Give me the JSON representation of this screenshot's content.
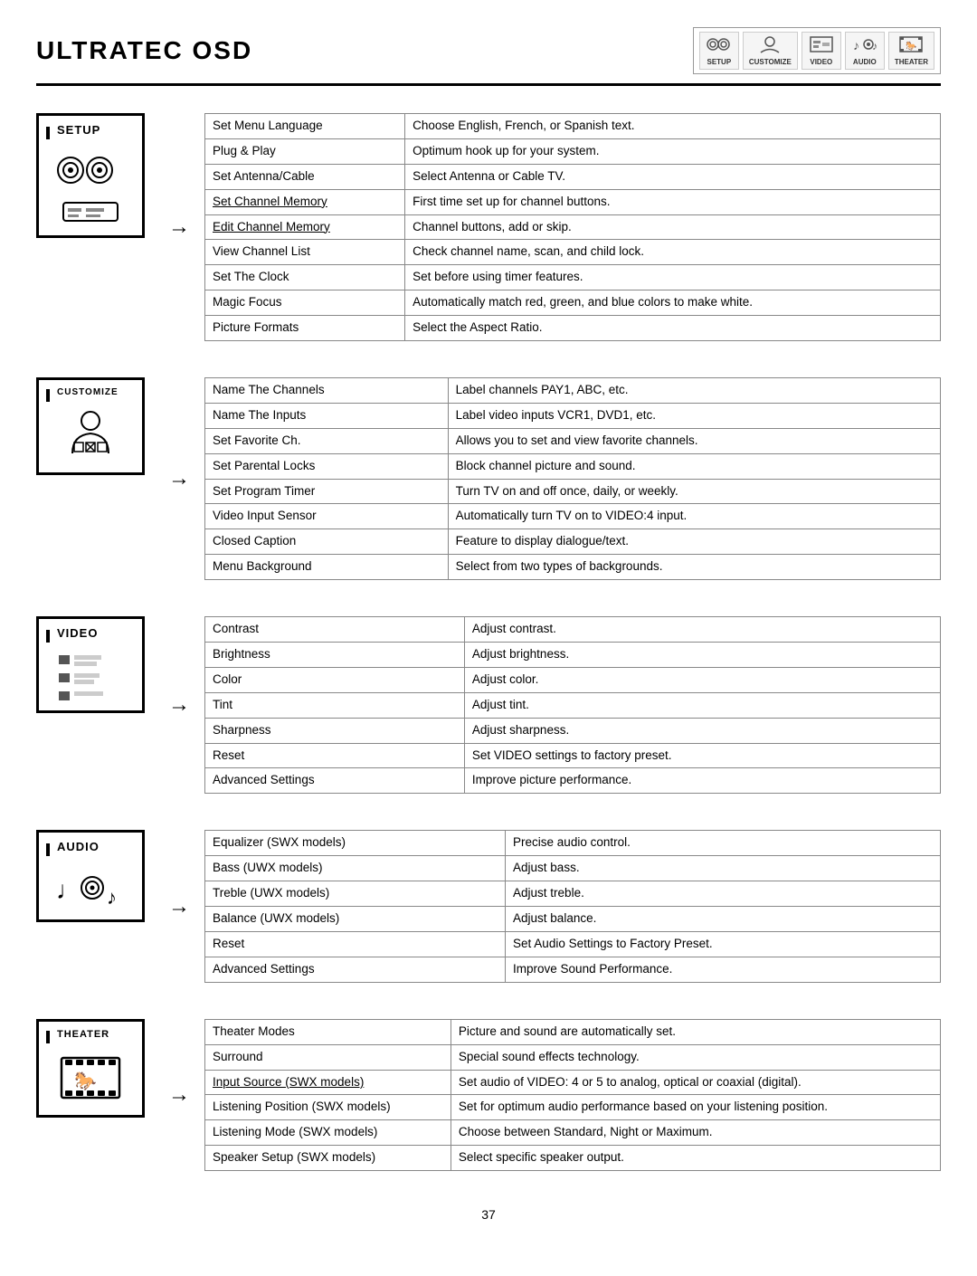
{
  "header": {
    "title": "ULTRATEC OSD",
    "nav": {
      "items": [
        {
          "label": "SETUP",
          "sym": "⚙"
        },
        {
          "label": "CUSTOMIZE",
          "sym": "👤"
        },
        {
          "label": "VIDEO",
          "sym": "▣"
        },
        {
          "label": "AUDIO",
          "sym": "♪"
        },
        {
          "label": "THEATER",
          "sym": "🎬"
        }
      ]
    }
  },
  "sections": [
    {
      "id": "setup",
      "label": "SETUP",
      "rows": [
        {
          "item": "Set Menu Language",
          "desc": "Choose English, French, or Spanish text."
        },
        {
          "item": "Plug & Play",
          "desc": "Optimum hook up for your system."
        },
        {
          "item": "Set Antenna/Cable",
          "desc": "Select Antenna or Cable TV."
        },
        {
          "item": "Set Channel Memory",
          "desc": "First time set up for channel buttons.",
          "underline": true
        },
        {
          "item": "Edit Channel Memory",
          "desc": "Channel buttons, add or skip.",
          "underline": true
        },
        {
          "item": "View Channel List",
          "desc": "Check channel name, scan, and child lock."
        },
        {
          "item": "Set The Clock",
          "desc": "Set before using timer features."
        },
        {
          "item": "Magic Focus",
          "desc": "Automatically match red, green, and blue colors to make white."
        },
        {
          "item": "Picture Formats",
          "desc": "Select  the Aspect Ratio."
        }
      ]
    },
    {
      "id": "customize",
      "label": "CUSTOMIZE",
      "rows": [
        {
          "item": "Name The Channels",
          "desc": "Label channels PAY1, ABC, etc."
        },
        {
          "item": "Name The Inputs",
          "desc": "Label video inputs VCR1, DVD1, etc."
        },
        {
          "item": "Set Favorite Ch.",
          "desc": "Allows you to set and view favorite channels."
        },
        {
          "item": "Set Parental Locks",
          "desc": "Block channel picture and sound."
        },
        {
          "item": "Set Program Timer",
          "desc": "Turn TV on and off once, daily, or weekly."
        },
        {
          "item": "Video Input Sensor",
          "desc": "Automatically turn TV on to VIDEO:4 input."
        },
        {
          "item": "Closed Caption",
          "desc": "Feature to display dialogue/text."
        },
        {
          "item": "Menu Background",
          "desc": "Select from two types of backgrounds."
        }
      ]
    },
    {
      "id": "video",
      "label": "VIDEO",
      "rows": [
        {
          "item": "Contrast",
          "desc": "Adjust contrast."
        },
        {
          "item": "Brightness",
          "desc": "Adjust brightness."
        },
        {
          "item": "Color",
          "desc": "Adjust color."
        },
        {
          "item": "Tint",
          "desc": "Adjust tint."
        },
        {
          "item": "Sharpness",
          "desc": "Adjust sharpness."
        },
        {
          "item": "Reset",
          "desc": "Set VIDEO settings to factory preset."
        },
        {
          "item": "Advanced\n    Settings",
          "desc": "Improve picture performance."
        }
      ]
    },
    {
      "id": "audio",
      "label": "AUDIO",
      "rows": [
        {
          "item": "Equalizer (SWX models)",
          "desc": "Precise audio control."
        },
        {
          "item": "Bass (UWX models)",
          "desc": "Adjust bass."
        },
        {
          "item": "Treble (UWX models)",
          "desc": "Adjust treble."
        },
        {
          "item": "Balance (UWX models)",
          "desc": "Adjust balance."
        },
        {
          "item": "Reset",
          "desc": "Set Audio Settings to Factory Preset."
        },
        {
          "item": "Advanced Settings",
          "desc": "Improve Sound Performance."
        }
      ]
    },
    {
      "id": "theater",
      "label": "THEATER",
      "rows": [
        {
          "item": "Theater Modes",
          "desc": "Picture and sound are automatically set."
        },
        {
          "item": "Surround",
          "desc": "Special sound effects technology."
        },
        {
          "item": "Input Source (SWX models)",
          "desc": "Set audio of VIDEO: 4 or 5 to analog, optical or coaxial (digital).",
          "underline": true
        },
        {
          "item": "Listening Position\n    (SWX models)",
          "desc": "Set for optimum audio performance based on your listening position."
        },
        {
          "item": "Listening Mode\n    (SWX models)",
          "desc": "Choose between Standard, Night or Maximum."
        },
        {
          "item": "Speaker Setup\n    (SWX models)",
          "desc": "Select specific speaker output."
        }
      ]
    }
  ],
  "page_number": "37",
  "arrow": "→"
}
